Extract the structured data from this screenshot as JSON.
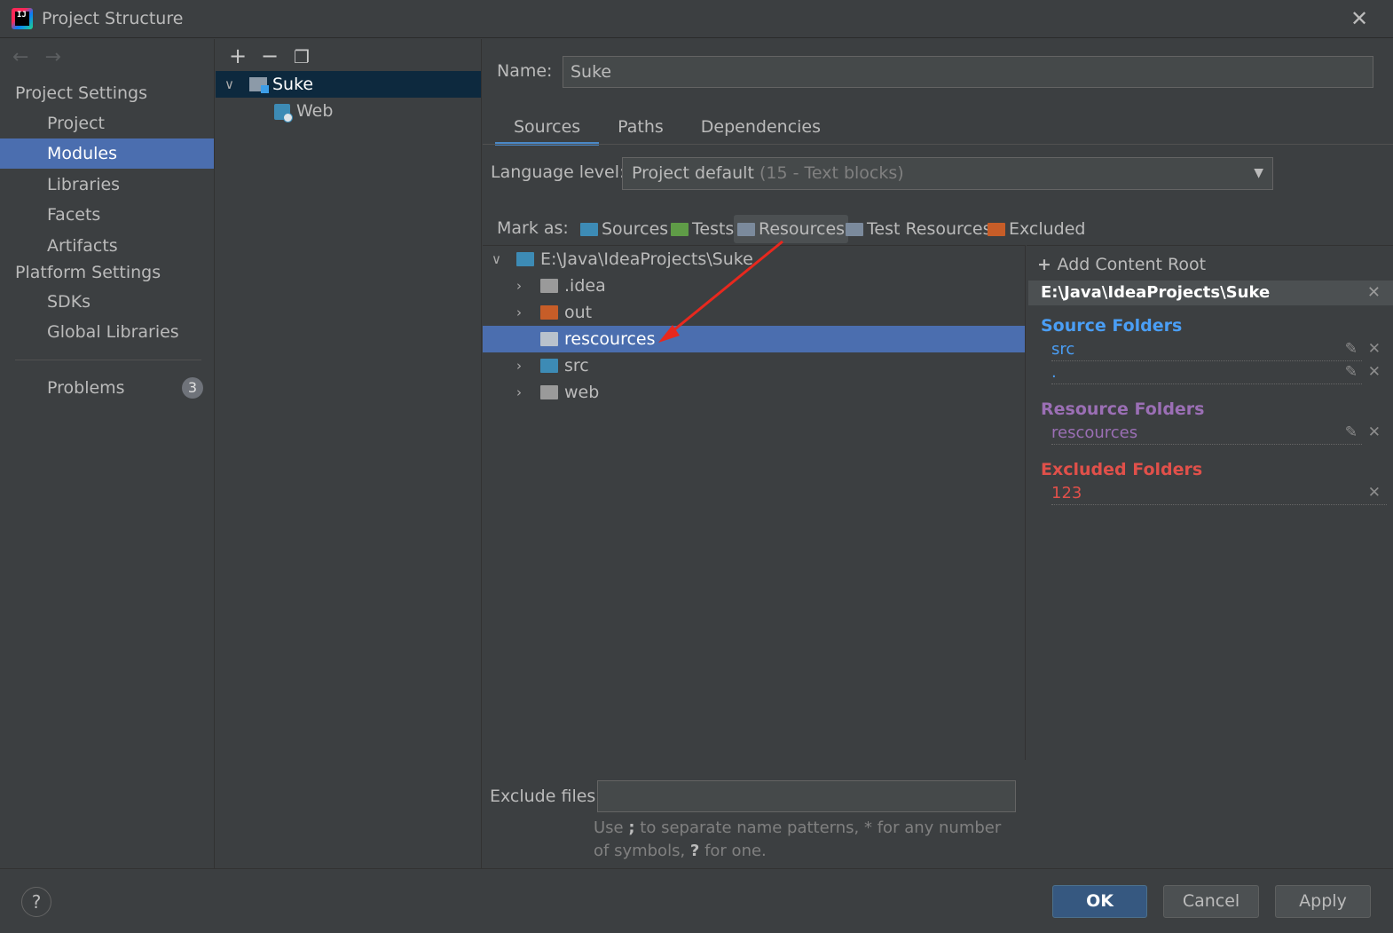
{
  "window": {
    "title": "Project Structure"
  },
  "nav": {
    "back": "←",
    "forward": "→",
    "project_settings": "Project Settings",
    "platform_settings": "Platform Settings",
    "project_items": [
      "Project",
      "Modules",
      "Libraries",
      "Facets",
      "Artifacts"
    ],
    "platform_items": [
      "SDKs",
      "Global Libraries"
    ],
    "selected": "Modules",
    "problems": "Problems",
    "problems_count": "3"
  },
  "modules": {
    "tree": [
      {
        "label": "Suke",
        "selected": true
      },
      {
        "label": "Web",
        "selected": false
      }
    ]
  },
  "module": {
    "name_label": "Name:",
    "name_value": "Suke",
    "tabs": [
      "Sources",
      "Paths",
      "Dependencies"
    ],
    "active_tab": "Sources",
    "language_label": "Language level:",
    "language_value": "Project default",
    "language_hint": "(15 - Text blocks)",
    "mark_as_label": "Mark as:",
    "mark_as": [
      {
        "label": "Sources",
        "color": "#3d8bb5"
      },
      {
        "label": "Tests",
        "color": "#5f9c47"
      },
      {
        "label": "Resources",
        "color": "#7b8a9c"
      },
      {
        "label": "Test Resources",
        "color": "#7b8a9c"
      },
      {
        "label": "Excluded",
        "color": "#c75d28"
      }
    ],
    "source_tree": {
      "root": "E:\\Java\\IdeaProjects\\Suke",
      "children": [
        {
          "label": ".idea",
          "color": "#9a9a9a"
        },
        {
          "label": "out",
          "color": "#c75d28"
        },
        {
          "label": "rescources",
          "color": "#7b8a9c",
          "selected": true
        },
        {
          "label": "src",
          "color": "#3d8bb5"
        },
        {
          "label": "web",
          "color": "#9a9a9a"
        }
      ]
    },
    "exclude_label": "Exclude files:",
    "exclude_value": "",
    "hint_pre": "Use ",
    "hint_semicolon": ";",
    "hint_mid": " to separate name patterns, * for any number of symbols, ",
    "hint_q": "?",
    "hint_post": " for one."
  },
  "content_roots": {
    "add_label": "Add Content Root",
    "root_path": "E:\\Java\\IdeaProjects\\Suke",
    "source_title": "Source Folders",
    "source_items": [
      "src",
      "."
    ],
    "resource_title": "Resource Folders",
    "resource_items": [
      "rescources"
    ],
    "excluded_title": "Excluded Folders",
    "excluded_items": [
      "123"
    ],
    "colors": {
      "source": "#4a9ef5",
      "resource": "#9b6fb5",
      "excluded": "#e0504a"
    }
  },
  "buttons": {
    "help": "?",
    "ok": "OK",
    "cancel": "Cancel",
    "apply": "Apply"
  }
}
